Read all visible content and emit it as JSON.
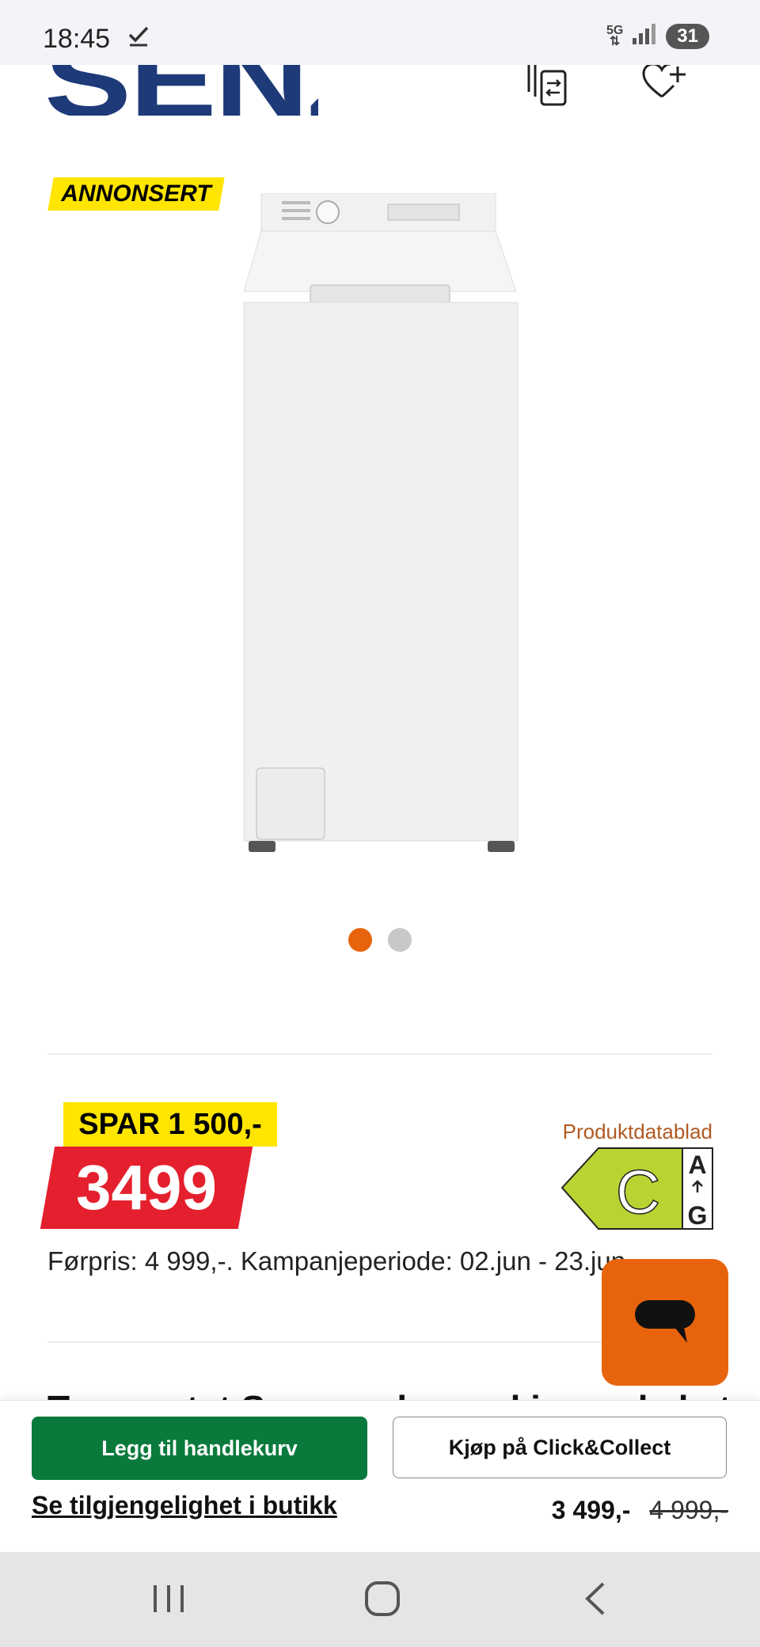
{
  "status_bar": {
    "time": "18:45",
    "network": "5G",
    "battery": "31"
  },
  "header": {
    "logo": "SENZ"
  },
  "product": {
    "sponsored_badge": "ANNONSERT",
    "image_dots": {
      "count": 2,
      "active_index": 0
    }
  },
  "pricing": {
    "save_badge": "SPAR 1 500,-",
    "price": "3499",
    "datasheet_link": "Produktdatablad",
    "energy": {
      "class": "C",
      "top": "A",
      "bottom": "G"
    },
    "prior_price_text": "Førpris: 4 999,-. Kampanjeperiode: 02.jun - 23.jun"
  },
  "peek_heading": "Toppmatet Senz vaskemaskin med ekstra",
  "bottom_bar": {
    "add_to_cart": "Legg til handlekurv",
    "click_collect": "Kjøp på Click&Collect",
    "availability": "Se tilgjengelighet i butikk",
    "current_price": "3 499,-",
    "old_price": "4 999,-"
  },
  "colors": {
    "brand_blue": "#1e3a78",
    "badge_yellow": "#ffe500",
    "price_red": "#e5202e",
    "cart_green": "#0a7a3c",
    "accent_orange": "#e8640c",
    "energy_green": "#b8d432"
  }
}
